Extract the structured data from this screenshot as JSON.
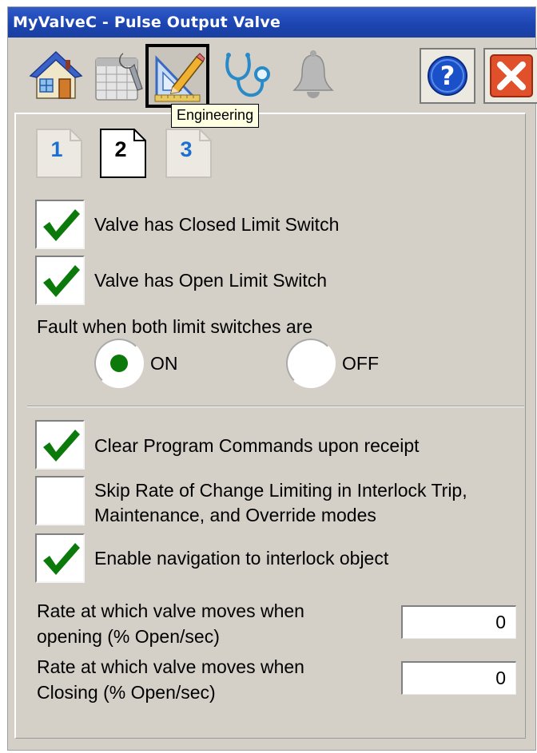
{
  "window": {
    "title": "MyValveC - Pulse Output Valve"
  },
  "toolbar": {
    "buttons": [
      {
        "name": "home",
        "icon": "home-icon"
      },
      {
        "name": "maintenance",
        "icon": "maintenance-icon"
      },
      {
        "name": "engineering",
        "icon": "engineering-icon",
        "selected": true
      },
      {
        "name": "diagnostics",
        "icon": "stethoscope-icon"
      },
      {
        "name": "alarms",
        "icon": "bell-icon",
        "disabled": true
      },
      {
        "name": "help",
        "icon": "help-icon"
      },
      {
        "name": "close",
        "icon": "close-icon"
      }
    ],
    "tooltip": "Engineering"
  },
  "pages": {
    "tabs": [
      {
        "label": "1",
        "selected": false
      },
      {
        "label": "2",
        "selected": true
      },
      {
        "label": "3",
        "selected": false
      }
    ]
  },
  "limit_switches": {
    "closed_label": "Valve has Closed Limit Switch",
    "closed_checked": true,
    "open_label": "Valve has Open Limit Switch",
    "open_checked": true,
    "fault_label": "Fault when both limit switches are",
    "on_label": "ON",
    "off_label": "OFF",
    "selected": "ON"
  },
  "options": {
    "clear_cmds_label": "Clear Program Commands upon receipt",
    "clear_cmds_checked": true,
    "skip_roc_label_line1": "Skip Rate of Change Limiting in Interlock Trip,",
    "skip_roc_label_line2": "Maintenance, and Override modes",
    "skip_roc_checked": false,
    "enable_nav_label": "Enable navigation to interlock object",
    "enable_nav_checked": true
  },
  "rates": {
    "open_label_line1": "Rate at which valve moves when",
    "open_label_line2": "opening (% Open/sec)",
    "open_value": "0",
    "close_label_line1": "Rate at which valve moves when",
    "close_label_line2": "Closing (% Open/sec)",
    "close_value": "0"
  },
  "colors": {
    "check_green": "#0b7a0b",
    "title_blue": "#1b44b0",
    "page_tab_blue": "#1b6fd0"
  }
}
